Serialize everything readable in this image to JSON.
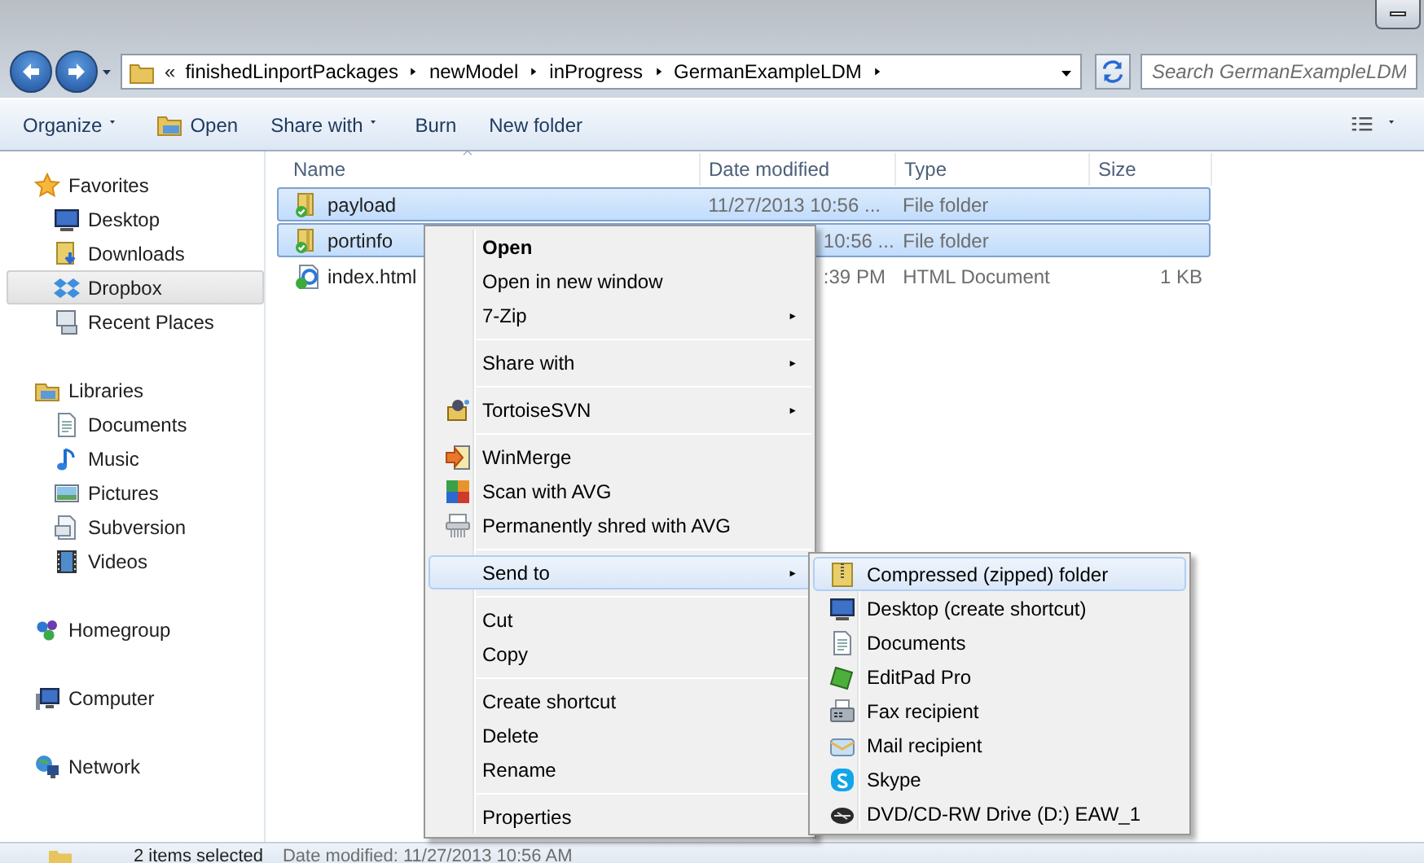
{
  "address_bar": {
    "overflow": "«",
    "breadcrumbs": [
      "finishedLinportPackages",
      "newModel",
      "inProgress",
      "GermanExampleLDM"
    ]
  },
  "search": {
    "placeholder": "Search GermanExampleLDM"
  },
  "toolbar": [
    {
      "label": "Organize",
      "kind": "dropdown"
    },
    {
      "label": "Open",
      "kind": "icon"
    },
    {
      "label": "Share with",
      "kind": "dropdown"
    },
    {
      "label": "Burn",
      "kind": "plain"
    },
    {
      "label": "New folder",
      "kind": "plain"
    }
  ],
  "sidebar": [
    {
      "label": "Favorites",
      "children": [
        {
          "label": "Desktop",
          "selected": false
        },
        {
          "label": "Downloads",
          "selected": false
        },
        {
          "label": "Dropbox",
          "selected": true
        },
        {
          "label": "Recent Places",
          "selected": false
        }
      ]
    },
    {
      "label": "Libraries",
      "children": [
        {
          "label": "Documents",
          "selected": false
        },
        {
          "label": "Music",
          "selected": false
        },
        {
          "label": "Pictures",
          "selected": false
        },
        {
          "label": "Subversion",
          "selected": false
        },
        {
          "label": "Videos",
          "selected": false
        }
      ]
    },
    {
      "label": "Homegroup"
    },
    {
      "label": "Computer"
    },
    {
      "label": "Network"
    }
  ],
  "table": {
    "columns": [
      "Name",
      "Date modified",
      "Type",
      "Size"
    ],
    "rows": [
      {
        "name": "payload",
        "date_modified": "11/27/2013 10:56 ...",
        "covered": false,
        "type": "File folder",
        "selected": true
      },
      {
        "name": "portinfo",
        "date_modified": "10:56 ...",
        "covered": true,
        "type": "File folder",
        "selected": true
      },
      {
        "name": "index.html",
        "date_modified": ":39 PM",
        "covered": true,
        "type": "HTML Document",
        "size": "1 KB",
        "selected": false
      }
    ]
  },
  "context_menu": {
    "groups": [
      [
        {
          "label": "Open",
          "default": true,
          "has_submenu": false,
          "selected": false
        },
        {
          "label": "Open in new window",
          "default": false,
          "has_submenu": false,
          "selected": false
        },
        {
          "label": "7-Zip",
          "default": false,
          "has_submenu": true,
          "selected": false
        }
      ],
      [
        {
          "label": "Share with",
          "default": false,
          "has_submenu": true,
          "selected": false
        }
      ],
      [
        {
          "label": "TortoiseSVN",
          "default": false,
          "has_submenu": true,
          "selected": false
        }
      ],
      [
        {
          "label": "WinMerge",
          "default": false,
          "has_submenu": false,
          "selected": false
        },
        {
          "label": "Scan with AVG",
          "default": false,
          "has_submenu": false,
          "selected": false
        },
        {
          "label": "Permanently shred with AVG",
          "default": false,
          "has_submenu": false,
          "selected": false
        }
      ],
      [
        {
          "label": "Send to",
          "default": false,
          "has_submenu": true,
          "selected": true
        }
      ],
      [
        {
          "label": "Cut",
          "default": false,
          "has_submenu": false,
          "selected": false
        },
        {
          "label": "Copy",
          "default": false,
          "has_submenu": false,
          "selected": false
        }
      ],
      [
        {
          "label": "Create shortcut",
          "default": false,
          "has_submenu": false,
          "selected": false
        },
        {
          "label": "Delete",
          "default": false,
          "has_submenu": false,
          "selected": false
        },
        {
          "label": "Rename",
          "default": false,
          "has_submenu": false,
          "selected": false
        }
      ],
      [
        {
          "label": "Properties",
          "default": false,
          "has_submenu": false,
          "selected": false
        }
      ]
    ]
  },
  "send_to_menu": {
    "items": [
      {
        "label": "Compressed (zipped) folder",
        "selected": true
      },
      {
        "label": "Desktop (create shortcut)",
        "selected": false
      },
      {
        "label": "Documents",
        "selected": false
      },
      {
        "label": "EditPad Pro",
        "selected": false
      },
      {
        "label": "Fax recipient",
        "selected": false
      },
      {
        "label": "Mail recipient",
        "selected": false
      },
      {
        "label": "Skype",
        "selected": false
      },
      {
        "label": "DVD/CD-RW Drive (D:) EAW_1",
        "selected": false
      }
    ]
  },
  "status_bar": {
    "summary": "2 items selected",
    "detail": "Date modified: 11/27/2013 10:56 AM"
  }
}
